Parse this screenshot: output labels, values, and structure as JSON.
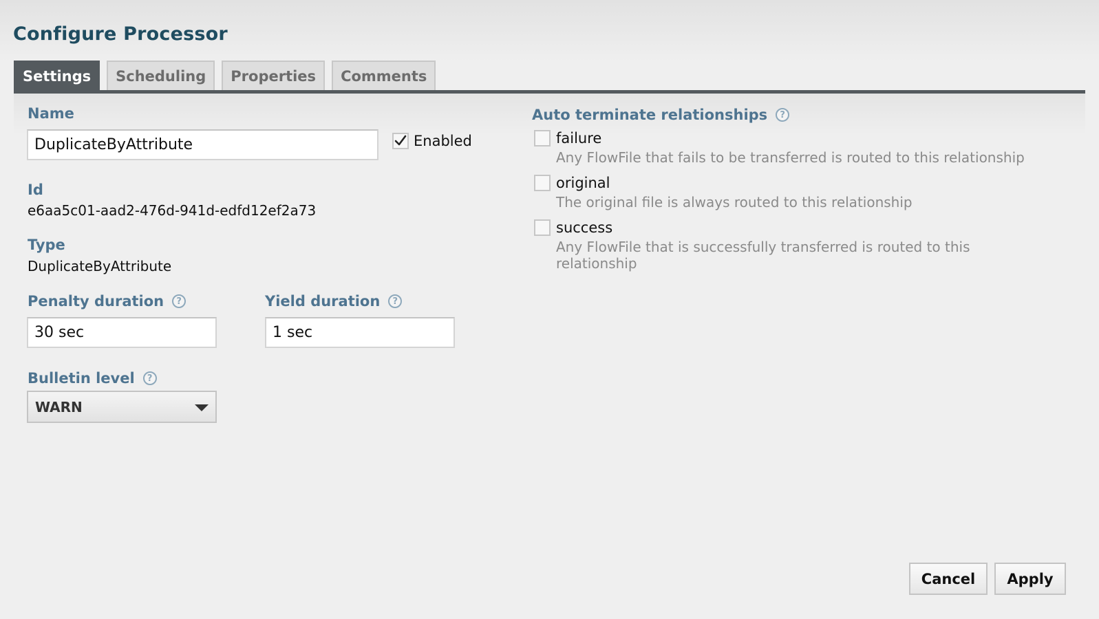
{
  "dialog": {
    "title": "Configure Processor"
  },
  "tabs": [
    {
      "label": "Settings",
      "active": true
    },
    {
      "label": "Scheduling",
      "active": false
    },
    {
      "label": "Properties",
      "active": false
    },
    {
      "label": "Comments",
      "active": false
    }
  ],
  "settings": {
    "name_label": "Name",
    "name_value": "DuplicateByAttribute",
    "enabled_label": "Enabled",
    "enabled_checked": true,
    "id_label": "Id",
    "id_value": "e6aa5c01-aad2-476d-941d-edfd12ef2a73",
    "type_label": "Type",
    "type_value": "DuplicateByAttribute",
    "penalty_label": "Penalty duration",
    "penalty_value": "30 sec",
    "yield_label": "Yield duration",
    "yield_value": "1 sec",
    "bulletin_label": "Bulletin level",
    "bulletin_value": "WARN",
    "help_glyph": "?"
  },
  "relationships": {
    "title": "Auto terminate relationships",
    "items": [
      {
        "name": "failure",
        "description": "Any FlowFile that fails to be transferred is routed to this relationship",
        "checked": false
      },
      {
        "name": "original",
        "description": "The original file is always routed to this relationship",
        "checked": false
      },
      {
        "name": "success",
        "description": "Any FlowFile that is successfully transferred is routed to this relationship",
        "checked": false
      }
    ]
  },
  "buttons": {
    "cancel_label": "Cancel",
    "apply_label": "Apply"
  },
  "colors": {
    "accent": "#4e7490",
    "title": "#1f4c60",
    "tab_active": "#545a5e"
  },
  "icons": {
    "help": "help-icon",
    "checkmark": "checkmark-icon",
    "dropdown": "chevron-down-icon"
  }
}
